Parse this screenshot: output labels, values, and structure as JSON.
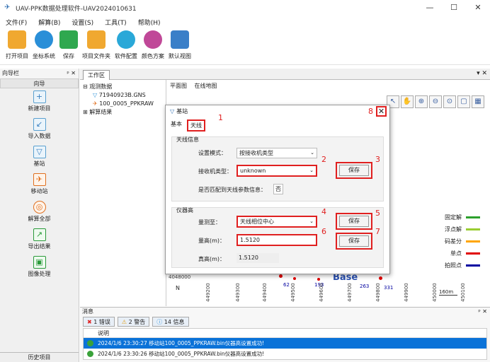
{
  "window": {
    "title": "UAV-PPK数据处理软件-UAV2024010631",
    "controls": [
      "—",
      "☐",
      "✕"
    ]
  },
  "menu": [
    "文件(F)",
    "解算(B)",
    "设置(S)",
    "工具(T)",
    "帮助(H)"
  ],
  "toolbar": [
    {
      "label": "打开项目",
      "icon": "folder-open-icon",
      "color": "#f0a830"
    },
    {
      "label": "坐标系统",
      "icon": "globe-icon",
      "color": "#2a8fd8"
    },
    {
      "label": "保存",
      "icon": "save-icon",
      "color": "#2fa84f"
    },
    {
      "label": "项目文件夹",
      "icon": "project-folder-icon",
      "color": "#f0a830"
    },
    {
      "label": "软件配置",
      "icon": "config-icon",
      "color": "#2aa8d8"
    },
    {
      "label": "颜色方案",
      "icon": "palette-icon",
      "color": "#c04898"
    },
    {
      "label": "默认视图",
      "icon": "default-view-icon",
      "color": "#3a7fc8"
    }
  ],
  "nav": {
    "title": "向导栏",
    "subtitle": "向导",
    "items": [
      {
        "label": "新建项目",
        "icon": "new-project-icon",
        "glyph": "+"
      },
      {
        "label": "导入数据",
        "icon": "import-icon",
        "glyph": "↙"
      },
      {
        "label": "基站",
        "icon": "base-station-icon",
        "glyph": "▽"
      },
      {
        "label": "移动站",
        "icon": "rover-icon",
        "glyph": "✈"
      },
      {
        "label": "解算全部",
        "icon": "solve-all-icon",
        "glyph": "◎"
      },
      {
        "label": "导出结果",
        "icon": "export-icon",
        "glyph": "↗"
      },
      {
        "label": "图像处理",
        "icon": "image-process-icon",
        "glyph": "▣"
      }
    ],
    "history": "历史项目"
  },
  "workspace": {
    "tab": "工作区",
    "controls": "▾ ✕"
  },
  "tree": [
    "观测数据",
    "71940923B.GNS",
    "100_0005_PPKRAW",
    "解算结果"
  ],
  "map": {
    "tabs": [
      "平面图",
      "在线地图"
    ],
    "legend": [
      {
        "label": "固定解",
        "color": "#2ca02c"
      },
      {
        "label": "浮点解",
        "color": "#9acd32"
      },
      {
        "label": "码差分",
        "color": "#ffa500"
      },
      {
        "label": "单点",
        "color": "#e00000"
      },
      {
        "label": "拍照点",
        "color": "#0000a0"
      }
    ],
    "ticks": [
      "4048000",
      "449200",
      "449300",
      "449400",
      "449500",
      "449600",
      "449700",
      "449800",
      "449900",
      "450000",
      "450100"
    ],
    "labels": [
      "62",
      "193",
      "263",
      "331",
      "Base"
    ],
    "scale": "160m",
    "north": "N"
  },
  "dialog": {
    "title": "基站",
    "tabs": [
      "基本",
      "天线"
    ],
    "close": "✕",
    "antenna_group": "天线信息",
    "setting_mode_label": "设置模式：",
    "setting_mode_value": "按接收机类型",
    "receiver_type_label": "接收机类型：",
    "receiver_type_value": "unknown",
    "save_label": "保存",
    "match_label": "是否匹配到天线参数信息：",
    "match_value": "否",
    "height_group": "仪器高",
    "measure_to_label": "量测至：",
    "measure_to_value": "天线相位中心",
    "measured_height_label": "量高(m)：",
    "measured_height_value": "1.5120",
    "true_height_label": "真高(m)：",
    "true_height_value": "1.5120",
    "markers": [
      "1",
      "2",
      "3",
      "4",
      "5",
      "6",
      "7",
      "8"
    ]
  },
  "messages": {
    "title": "消息",
    "tabs": [
      "1 错误",
      "2 警告",
      "14 信息"
    ],
    "column": "说明",
    "rows": [
      "2024/1/6 23:30:27  移动站100_0005_PPKRAW.bin仪器高设置成功!",
      "2024/1/6 23:30:26  移动站100_0005_PPKRAW.bin仪器高设置成功!"
    ]
  }
}
